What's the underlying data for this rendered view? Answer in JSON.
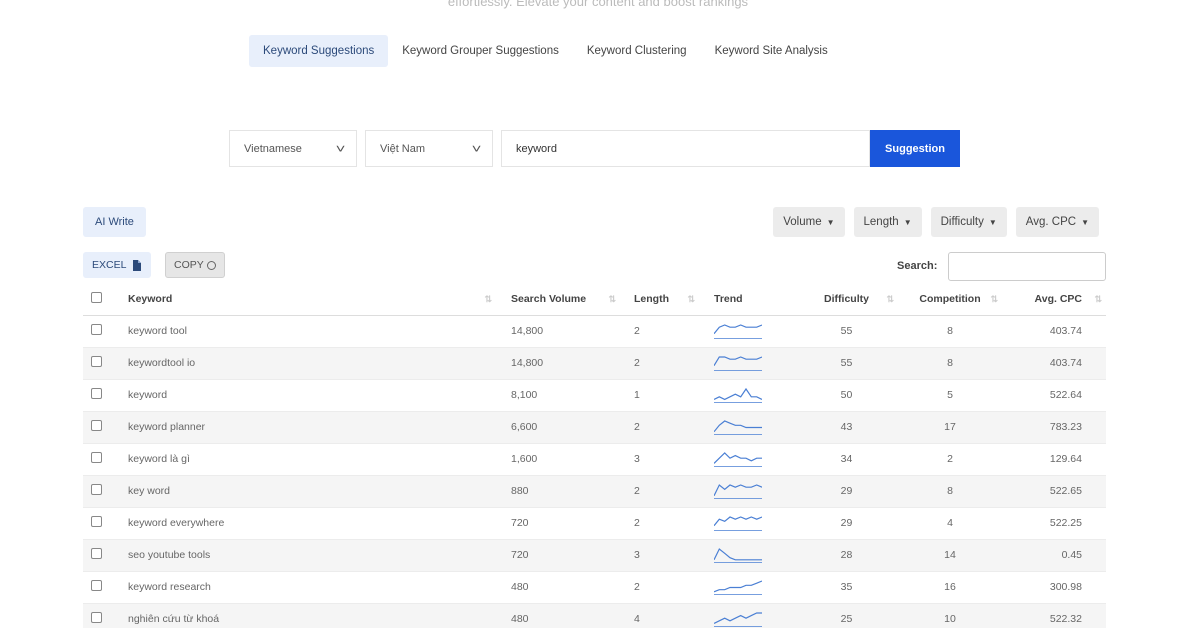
{
  "tagline": "effortlessly. Elevate your content and boost rankings",
  "tabs": [
    {
      "label": "Keyword Suggestions",
      "active": true
    },
    {
      "label": "Keyword Grouper Suggestions",
      "active": false
    },
    {
      "label": "Keyword Clustering",
      "active": false
    },
    {
      "label": "Keyword Site Analysis",
      "active": false
    }
  ],
  "search": {
    "language": "Vietnamese",
    "country": "Việt Nam",
    "keyword_value": "keyword",
    "submit_label": "Suggestion"
  },
  "toolbar": {
    "ai_write_label": "AI Write",
    "excel_label": "EXCEL",
    "copy_label": "COPY",
    "search_label": "Search:",
    "filters": [
      "Volume",
      "Length",
      "Difficulty",
      "Avg. CPC"
    ]
  },
  "table": {
    "headers": {
      "keyword": "Keyword",
      "search_volume": "Search Volume",
      "length": "Length",
      "trend": "Trend",
      "difficulty": "Difficulty",
      "competition": "Competition",
      "avg_cpc": "Avg. CPC"
    },
    "rows": [
      {
        "keyword": "keyword tool",
        "search_volume": "14,800",
        "length": "2",
        "difficulty": "55",
        "competition": "8",
        "avg_cpc": "403.74",
        "trend": [
          2,
          5,
          6,
          5,
          5,
          6,
          5,
          5,
          5,
          6
        ]
      },
      {
        "keyword": "keywordtool io",
        "search_volume": "14,800",
        "length": "2",
        "difficulty": "55",
        "competition": "8",
        "avg_cpc": "403.74",
        "trend": [
          2,
          6,
          6,
          5,
          5,
          6,
          5,
          5,
          5,
          6
        ]
      },
      {
        "keyword": "keyword",
        "search_volume": "8,100",
        "length": "1",
        "difficulty": "50",
        "competition": "5",
        "avg_cpc": "522.64",
        "trend": [
          1,
          2,
          1,
          2,
          3,
          2,
          5,
          2,
          2,
          1
        ]
      },
      {
        "keyword": "keyword planner",
        "search_volume": "6,600",
        "length": "2",
        "difficulty": "43",
        "competition": "17",
        "avg_cpc": "783.23",
        "trend": [
          1,
          4,
          6,
          5,
          4,
          4,
          3,
          3,
          3,
          3
        ]
      },
      {
        "keyword": "keyword là gì",
        "search_volume": "1,600",
        "length": "3",
        "difficulty": "34",
        "competition": "2",
        "avg_cpc": "129.64",
        "trend": [
          1,
          3,
          5,
          3,
          4,
          3,
          3,
          2,
          3,
          3
        ]
      },
      {
        "keyword": "key word",
        "search_volume": "880",
        "length": "2",
        "difficulty": "29",
        "competition": "8",
        "avg_cpc": "522.65",
        "trend": [
          1,
          6,
          4,
          6,
          5,
          6,
          5,
          5,
          6,
          5
        ]
      },
      {
        "keyword": "keyword everywhere",
        "search_volume": "720",
        "length": "2",
        "difficulty": "29",
        "competition": "4",
        "avg_cpc": "522.25",
        "trend": [
          2,
          5,
          4,
          6,
          5,
          6,
          5,
          6,
          5,
          6
        ]
      },
      {
        "keyword": "seo youtube tools",
        "search_volume": "720",
        "length": "3",
        "difficulty": "28",
        "competition": "14",
        "avg_cpc": "0.45",
        "trend": [
          1,
          6,
          4,
          2,
          1,
          1,
          1,
          1,
          1,
          1
        ]
      },
      {
        "keyword": "keyword research",
        "search_volume": "480",
        "length": "2",
        "difficulty": "35",
        "competition": "16",
        "avg_cpc": "300.98",
        "trend": [
          1,
          2,
          2,
          3,
          3,
          3,
          4,
          4,
          5,
          6
        ]
      },
      {
        "keyword": "nghiên cứu từ khoá",
        "search_volume": "480",
        "length": "4",
        "difficulty": "25",
        "competition": "10",
        "avg_cpc": "522.32",
        "trend": [
          1,
          2,
          3,
          2,
          3,
          4,
          3,
          4,
          5,
          5
        ]
      }
    ]
  },
  "colors": {
    "accent": "#1a56db",
    "spark": "#4a7fd4",
    "tab_active_bg": "#e8effb"
  }
}
